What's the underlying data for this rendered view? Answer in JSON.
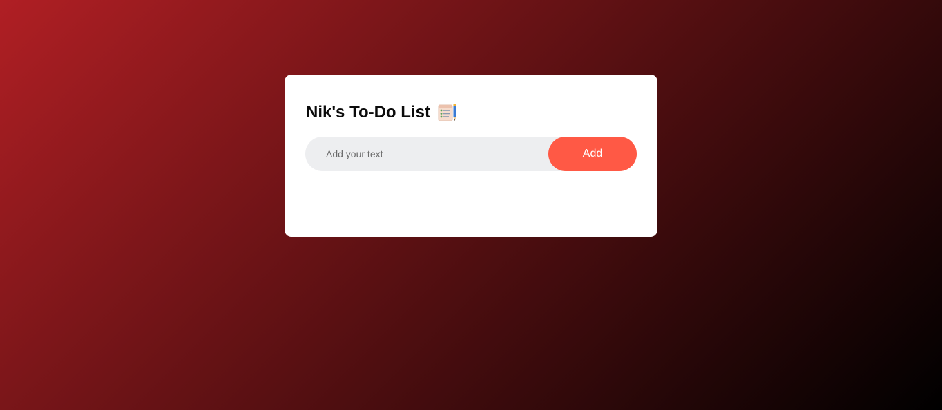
{
  "app": {
    "title": "Nik's To-Do List",
    "title_icon": "notepad-checklist-pencil-icon"
  },
  "input": {
    "placeholder": "Add your text",
    "value": ""
  },
  "add_button": {
    "label": "Add"
  },
  "tasks": [],
  "colors": {
    "background_gradient_start": "#b01f24",
    "background_gradient_end": "#000000",
    "card": "#ffffff",
    "input_background": "#edeef0",
    "accent": "#ff5945"
  }
}
